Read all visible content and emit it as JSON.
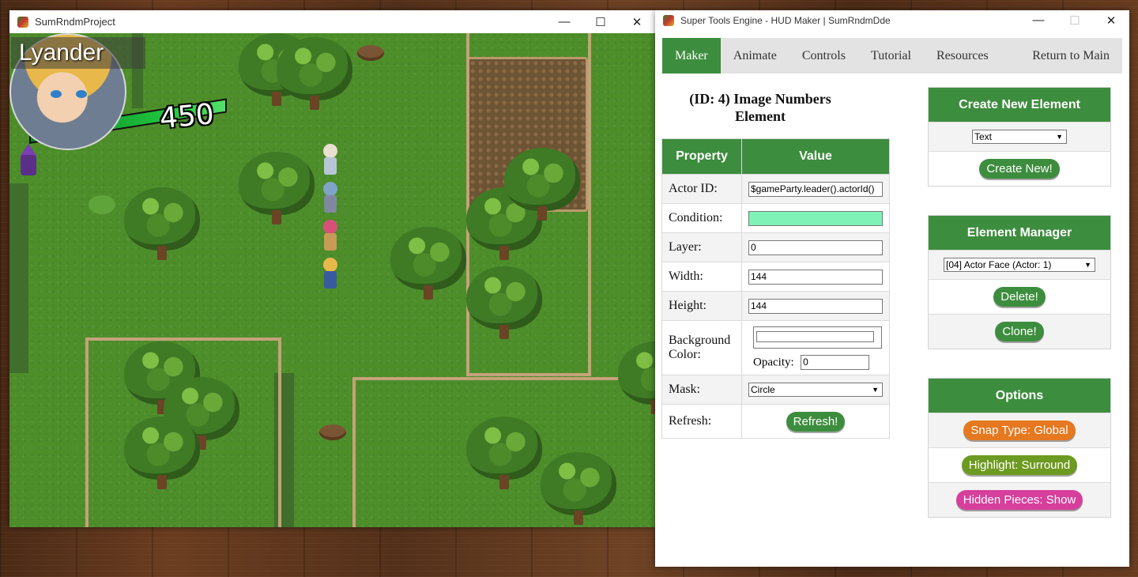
{
  "game_window": {
    "title": "SumRndmProject",
    "buttons": {
      "minimize": "—",
      "maximize": "☐",
      "close": "✕"
    },
    "hud": {
      "name": "Lyander",
      "number": "450"
    }
  },
  "tool_window": {
    "title": "Super Tools Engine - HUD Maker | SumRndmDde",
    "buttons": {
      "minimize": "—",
      "maximize": "☐",
      "close": "✕"
    },
    "nav": {
      "maker": "Maker",
      "animate": "Animate",
      "controls": "Controls",
      "tutorial": "Tutorial",
      "resources": "Resources",
      "return": "Return to Main"
    },
    "element_title_line1": "(ID: 4) Image Numbers",
    "element_title_line2": "Element",
    "table": {
      "header_property": "Property",
      "header_value": "Value",
      "actor_id_label": "Actor ID:",
      "actor_id_value": "$gameParty.leader().actorId()",
      "condition_label": "Condition:",
      "condition_value": "",
      "layer_label": "Layer:",
      "layer_value": "0",
      "width_label": "Width:",
      "width_value": "144",
      "height_label": "Height:",
      "height_value": "144",
      "bg_label_line1": "Background",
      "bg_label_line2": "Color:",
      "bg_value": "",
      "opacity_label": "Opacity:",
      "opacity_value": "0",
      "mask_label": "Mask:",
      "mask_value": "Circle",
      "refresh_label": "Refresh:",
      "refresh_button": "Refresh!"
    },
    "create_panel": {
      "title": "Create New Element",
      "select_value": "Text",
      "button": "Create New!"
    },
    "manager_panel": {
      "title": "Element Manager",
      "select_value": "[04] Actor Face (Actor: 1)",
      "delete_button": "Delete!",
      "clone_button": "Clone!"
    },
    "options_panel": {
      "title": "Options",
      "snap_button": "Snap Type: Global",
      "highlight_button": "Highlight: Surround",
      "hidden_button": "Hidden Pieces: Show"
    },
    "colors": {
      "accent_green": "#3d8d3e",
      "condition_field": "#7ef2b7",
      "snap_orange": "#e6781f",
      "highlight_olive": "#6d9a20",
      "hidden_magenta": "#d63f9c"
    }
  }
}
